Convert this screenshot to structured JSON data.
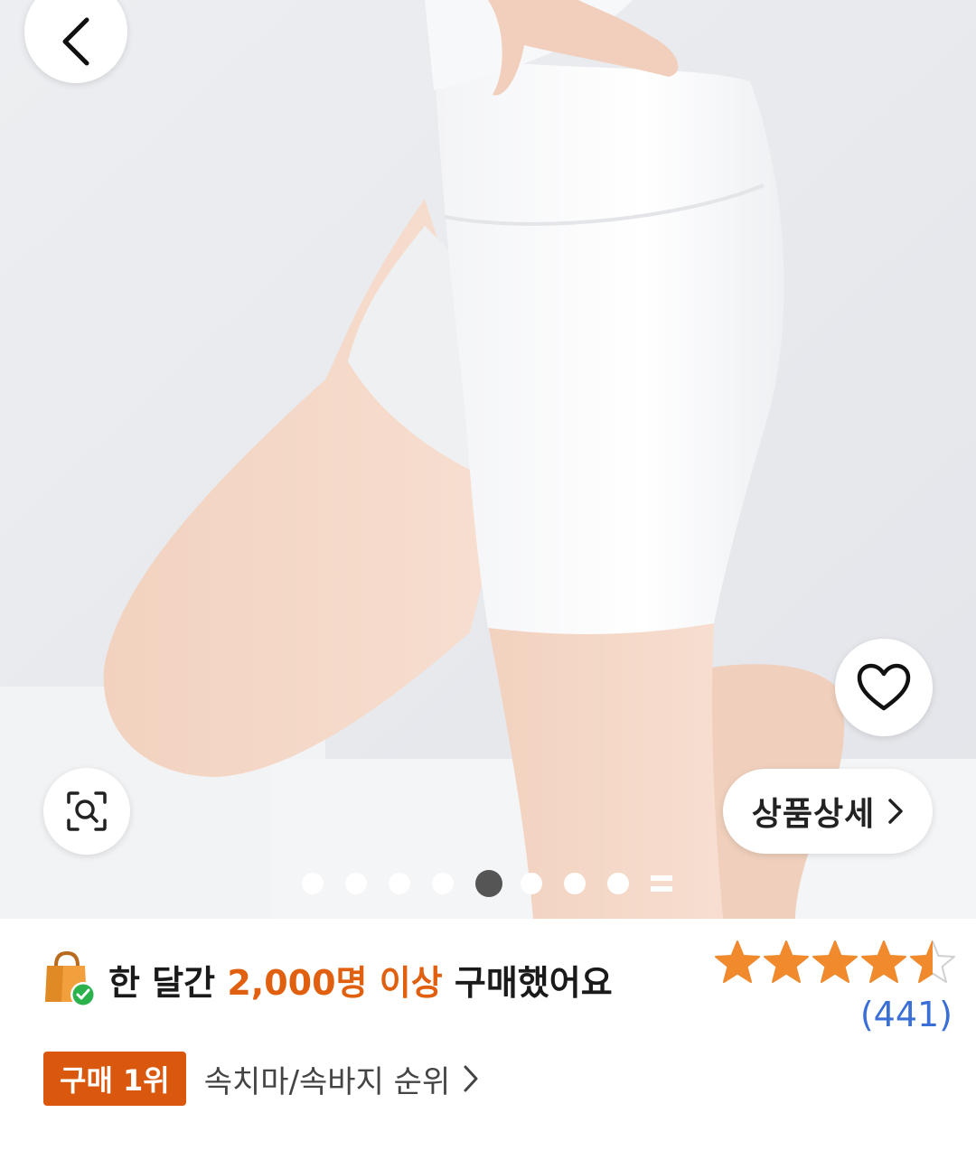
{
  "gallery": {
    "dot_count": 8,
    "active_index": 4,
    "like_icon": "heart-icon",
    "zoom_icon": "image-search-icon",
    "back_icon": "chevron-left-icon"
  },
  "detail_button": {
    "label": "상품상세"
  },
  "purchase": {
    "prefix": "한 달간 ",
    "highlight": "2,000명 이상",
    "suffix": " 구매했어요",
    "highlight_color": "#e0600f"
  },
  "rating": {
    "stars": 4.5,
    "review_count": "(441)",
    "star_color": "#f08a2c"
  },
  "rank": {
    "badge": "구매 1위",
    "link": "속치마/속바지 순위"
  }
}
